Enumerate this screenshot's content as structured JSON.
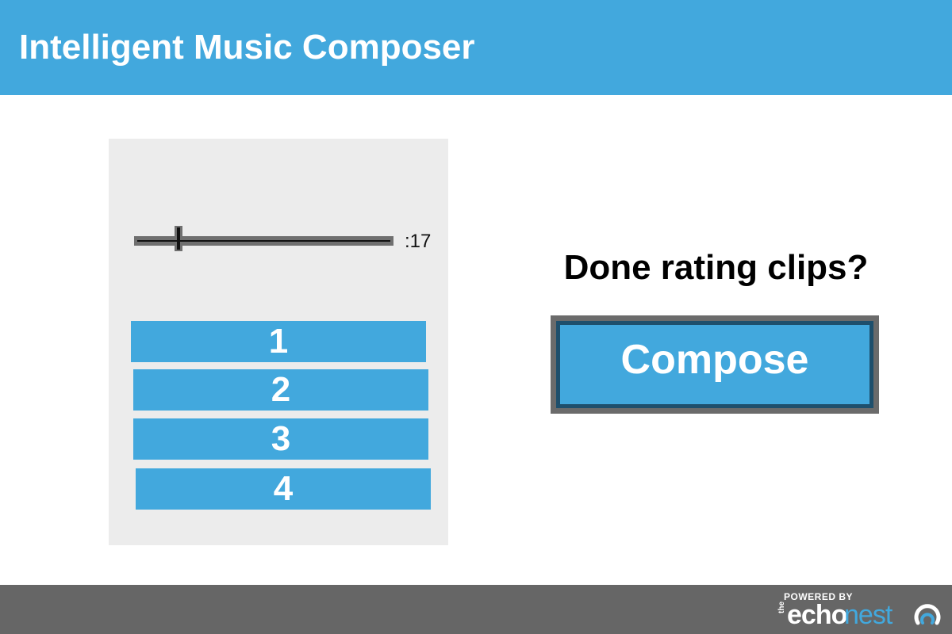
{
  "header": {
    "title": "Intelligent Music Composer"
  },
  "player": {
    "time_label": ":17",
    "progress_fraction": 0.17
  },
  "ratings": {
    "buttons": [
      "1",
      "2",
      "3",
      "4"
    ]
  },
  "prompt": {
    "text": "Done rating clips?"
  },
  "compose": {
    "label": "Compose"
  },
  "footer": {
    "logo_text": {
      "powered": "POWERED BY",
      "the": "the",
      "echo": "echo",
      "nest": "nest"
    }
  },
  "colors": {
    "accent": "#42a8dd",
    "footer": "#666666",
    "panel": "#ececec",
    "compose_border": "#1e4f6c"
  }
}
